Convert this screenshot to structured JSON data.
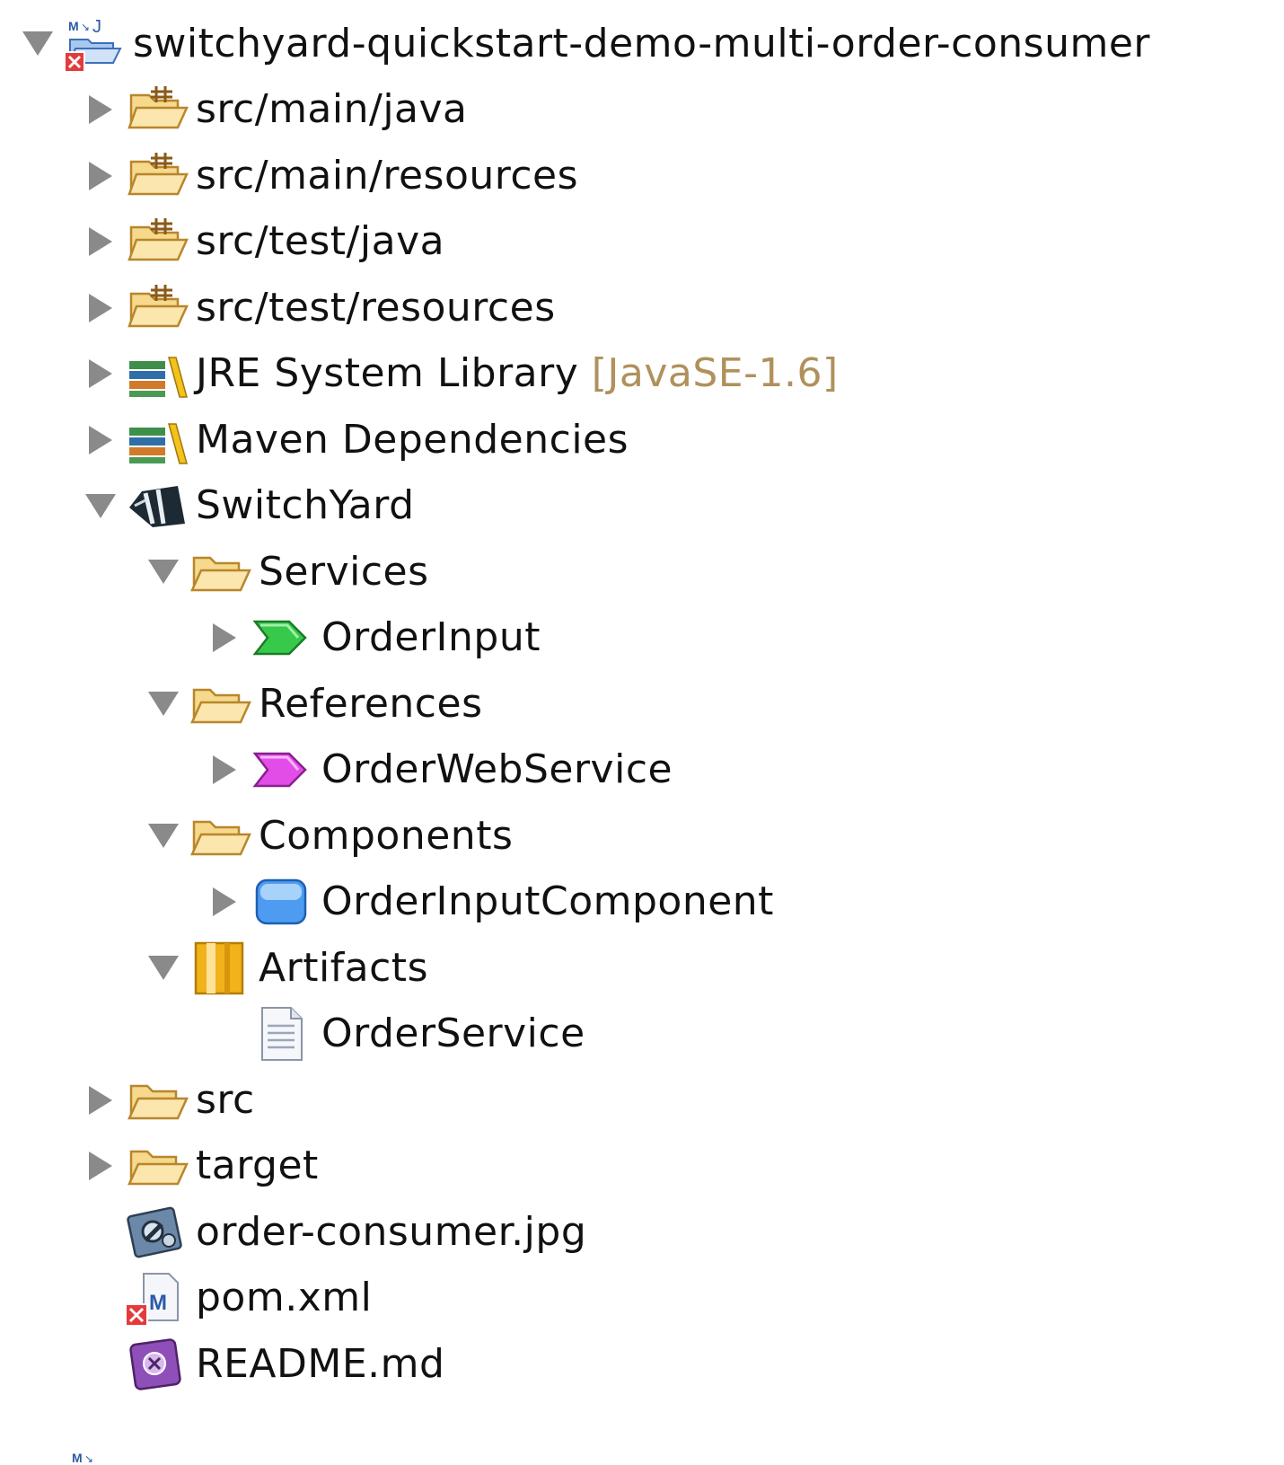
{
  "tree": {
    "project": {
      "label": "switchyard-quickstart-demo-multi-order-consumer",
      "icon": "maven-java-project-error-icon",
      "expanded": true
    },
    "items": [
      {
        "label": "src/main/java",
        "icon": "package-folder-icon",
        "expanded": false
      },
      {
        "label": "src/main/resources",
        "icon": "package-folder-icon",
        "expanded": false
      },
      {
        "label": "src/test/java",
        "icon": "package-folder-icon",
        "expanded": false
      },
      {
        "label": "src/test/resources",
        "icon": "package-folder-icon",
        "expanded": false
      },
      {
        "label": "JRE System Library",
        "decoration": "[JavaSE-1.6]",
        "icon": "library-icon",
        "expanded": false
      },
      {
        "label": "Maven Dependencies",
        "icon": "library-icon",
        "expanded": false
      },
      {
        "label": "SwitchYard",
        "icon": "switchyard-icon",
        "expanded": true
      },
      {
        "label": "Services",
        "icon": "folder-icon",
        "expanded": true
      },
      {
        "label": "OrderInput",
        "icon": "service-icon",
        "expanded": false
      },
      {
        "label": "References",
        "icon": "folder-icon",
        "expanded": true
      },
      {
        "label": "OrderWebService",
        "icon": "reference-icon",
        "expanded": false
      },
      {
        "label": "Components",
        "icon": "folder-icon",
        "expanded": true
      },
      {
        "label": "OrderInputComponent",
        "icon": "component-icon",
        "expanded": false
      },
      {
        "label": "Artifacts",
        "icon": "artifacts-icon",
        "expanded": true
      },
      {
        "label": "OrderService",
        "icon": "document-icon"
      },
      {
        "label": "src",
        "icon": "folder-icon",
        "expanded": false
      },
      {
        "label": "target",
        "icon": "folder-icon",
        "expanded": false
      },
      {
        "label": "order-consumer.jpg",
        "icon": "image-file-icon"
      },
      {
        "label": "pom.xml",
        "icon": "maven-pom-error-icon"
      },
      {
        "label": "README.md",
        "icon": "markdown-file-icon"
      }
    ]
  },
  "colors": {
    "folder": "#f3cf7a",
    "folder_outline": "#b8862b",
    "service_green": "#37c94a",
    "reference_magenta": "#e24de8",
    "component_blue": "#4d9cf2",
    "artifacts_orange": "#f1b21a",
    "twisty": "#8a8a8a",
    "decoration_text": "#b0915c"
  }
}
